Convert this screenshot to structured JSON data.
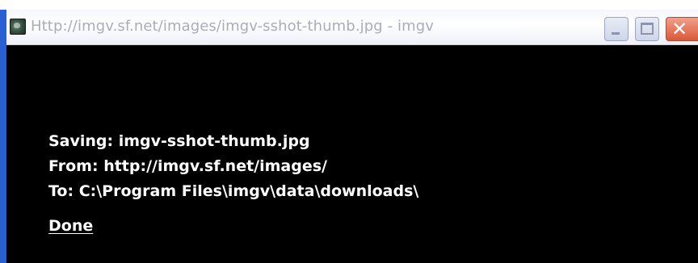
{
  "window": {
    "title": "Http://imgv.sf.net/images/imgv-sshot-thumb.jpg - imgv",
    "app_icon": "imgv-app-icon",
    "controls": {
      "minimize_icon": "minimize-icon",
      "maximize_icon": "maximize-icon",
      "close_icon": "close-icon",
      "close_glyph": "✕"
    }
  },
  "download": {
    "saving_line": "Saving: imgv-sshot-thumb.jpg",
    "from_line": "From: http://imgv.sf.net/images/",
    "to_line": "To: C:\\Program Files\\imgv\\data\\downloads\\",
    "done_label": "Done"
  },
  "colors": {
    "background": "#000000",
    "text": "#ffffff",
    "titlebar_text": "#a8adb8",
    "close_button": "#d9583a",
    "window_border": "#2a5fd4"
  }
}
